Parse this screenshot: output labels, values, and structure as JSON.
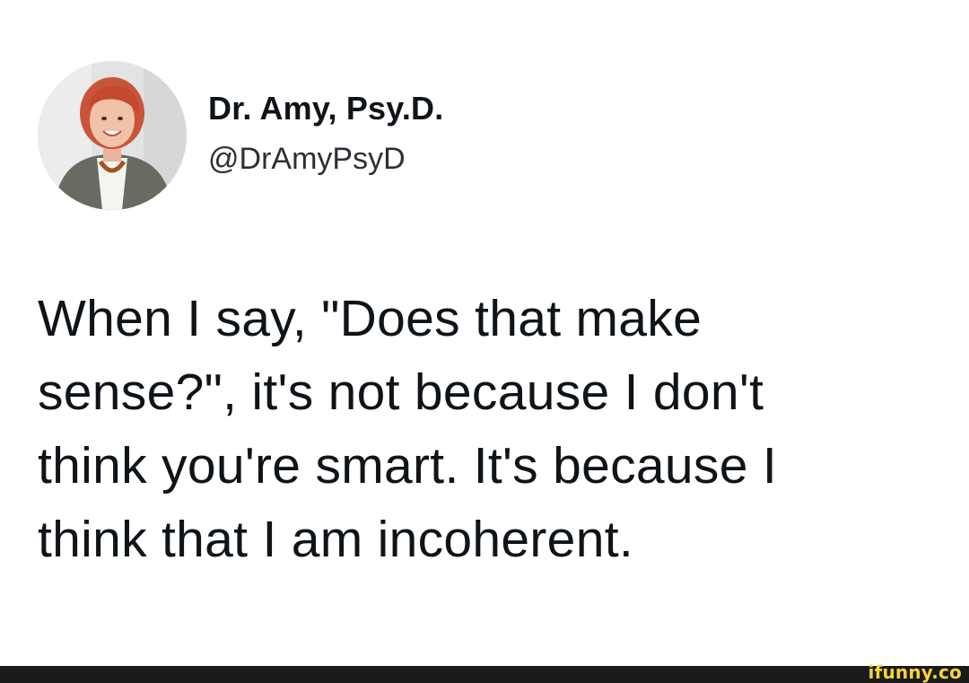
{
  "tweet": {
    "display_name": "Dr. Amy, Psy.D.",
    "handle": "@DrAmyPsyD",
    "text_lines": [
      "When I say, \"Does that make",
      "sense?\", it's not because I don't",
      "think you're smart. It's because I",
      "think that I am incoherent."
    ]
  },
  "footer": {
    "watermark": "ifunny.co"
  },
  "colors": {
    "background": "#ffffff",
    "text": "#0f1419",
    "footer_bar": "#1b1b1b",
    "watermark": "#f5d33a"
  }
}
